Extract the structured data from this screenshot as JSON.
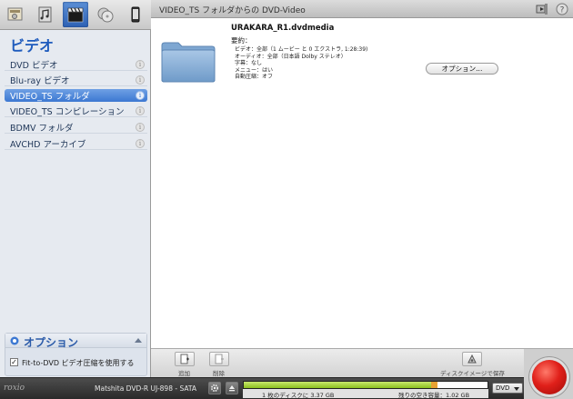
{
  "header": {
    "title": "VIDEO_TS フォルダからの DVD-Video"
  },
  "top_icons": [
    "data-disc-icon",
    "audio-disc-icon",
    "video-clapper-icon",
    "copy-disc-icon",
    "device-icon"
  ],
  "sidebar": {
    "title": "ビデオ",
    "items": [
      {
        "label": "DVD ビデオ",
        "selected": false
      },
      {
        "label": "Blu-ray ビデオ",
        "selected": false
      },
      {
        "label": "VIDEO_TS フォルダ",
        "selected": true
      },
      {
        "label": "VIDEO_TS コンピレーション",
        "selected": false
      },
      {
        "label": "BDMV フォルダ",
        "selected": false
      },
      {
        "label": "AVCHD アーカイブ",
        "selected": false
      }
    ],
    "info_glyph": "i"
  },
  "options_panel": {
    "title": "オプション",
    "checkbox_label": "Fit-to-DVD ビデオ圧縮を使用する",
    "checkbox_checked": true,
    "check_glyph": "✓"
  },
  "main": {
    "file_name": "URAKARA_R1.dvdmedia",
    "summary_label": "要約：",
    "details": [
      "ビデオ：全部（1 ムービー と 0 エクストラ, 1:28:39)",
      "オーディオ：全部（日本語 Dolby ステレオ）",
      "字幕：なし",
      "メニュー：はい",
      "自動圧縮：オフ"
    ],
    "options_button": "オプション..."
  },
  "toolbar": {
    "add_label": "追加",
    "remove_label": "削除",
    "save_image_label": "ディスクイメージで保存"
  },
  "statusbar": {
    "logo": "roxio",
    "drive": "Matshita DVD-R   UJ-898 - SATA",
    "discs_label": "1 枚のディスクに 3.37 GB",
    "free_label": "残りの空き容量：1.02 GB",
    "used_fraction": 0.77,
    "format": "DVD"
  },
  "colors": {
    "accent": "#3c78d2",
    "record": "#e0201a",
    "capacity_fill": "#8bbf1e"
  }
}
